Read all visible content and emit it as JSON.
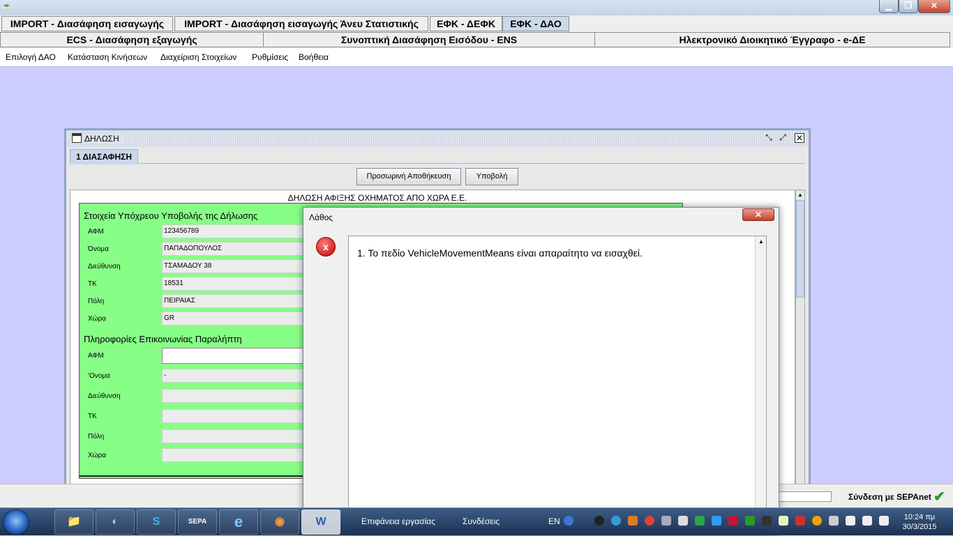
{
  "window": {
    "controls": {
      "minimize": "▁",
      "maximize": "❐",
      "close": "✕"
    }
  },
  "tabs_row1": [
    {
      "label": "IMPORT - Διασάφηση εισαγωγής",
      "selected": false
    },
    {
      "label": "IMPORT - Διασάφηση εισαγωγής Άνευ Στατιστικής",
      "selected": false
    },
    {
      "label": "ΕΦΚ - ΔΕΦΚ",
      "selected": false
    },
    {
      "label": "ΕΦΚ - ΔΑΟ",
      "selected": true
    }
  ],
  "tabs_row2": [
    {
      "label": "ECS - Διασάφηση εξαγωγής"
    },
    {
      "label": "Συνοπτική Διασάφηση Εισόδου - ENS"
    },
    {
      "label": "Ηλεκτρονικό Διοικητικό Έγγραφο - e-ΔΕ"
    }
  ],
  "menu": [
    "Επιλογή ΔΑΟ",
    "Κατάσταση Κινήσεων",
    "Διαχείριση Στοιχείων",
    "Ρυθμίσεις",
    "Βοήθεια"
  ],
  "internal_frame": {
    "title": "ΔΗΛΩΣΗ",
    "tab": "1 ΔΙΑΣΑΦΗΣΗ",
    "buttons": {
      "temp_save": "Προσωρινή Αποθήκευση",
      "submit": "Υποβολή"
    },
    "content_title": "ΔΗΛΩΣΗ ΑΦΙΞΗΣ ΟΧΗΜΑΤΟΣ ΑΠΟ ΧΩΡΑ Ε.Ε.",
    "section1": {
      "title": "Στοιχεία Υπόχρεου Υποβολής της Δήλωσης",
      "fields": [
        {
          "label": "ΑΦΜ",
          "value": "123456789"
        },
        {
          "label": "Όνομα",
          "value": "ΠΑΠΑΔΟΠΟΥΛΟΣ"
        },
        {
          "label": "Διεύθυνση",
          "value": "ΤΣΑΜΑΔΟΥ 38"
        },
        {
          "label": "ΤΚ",
          "value": "18531"
        },
        {
          "label": "Πόλη",
          "value": "ΠΕΙΡΑΙΑΣ"
        },
        {
          "label": "Χώρα",
          "value": "GR"
        }
      ]
    },
    "section2": {
      "title": "Πληροφορίες Επικοινωνίας Παραλήπτη",
      "fields": [
        {
          "label": "ΑΦΜ",
          "value": ""
        },
        {
          "label": "'Ονομα",
          "value": "-"
        },
        {
          "label": "Διεύθυνση",
          "value": ""
        },
        {
          "label": "ΤΚ",
          "value": ""
        },
        {
          "label": "Πόλη",
          "value": ""
        },
        {
          "label": "Χώρα",
          "value": ""
        }
      ]
    }
  },
  "dialog": {
    "title": "Λάθος",
    "close": "✕",
    "icon": "error-x-icon",
    "icon_glyph": "x",
    "messages": [
      "1.  Το πεδίο VehicleMovementMeans είναι απαραίτητο να εισαχθεί."
    ]
  },
  "status": {
    "connection": "Σύνδεση με SEPAnet"
  },
  "taskbar": {
    "apps": [
      {
        "name": "explorer",
        "glyph": "📁"
      },
      {
        "name": "app-2",
        "glyph": "◐"
      },
      {
        "name": "skype",
        "glyph": "S"
      },
      {
        "name": "sepa-desktop",
        "glyph": "SEPA"
      },
      {
        "name": "internet-explorer",
        "glyph": "e"
      },
      {
        "name": "firefox",
        "glyph": "◉"
      },
      {
        "name": "word",
        "glyph": "W"
      }
    ],
    "toolbars": [
      "Επιφάνεια εργασίας",
      "Συνδέσεις"
    ],
    "language": "EN",
    "clock": {
      "time": "10:24 πμ",
      "date": "30/3/2015"
    }
  },
  "colors": {
    "desktop_bg": "#ccccff",
    "panel_green": "#87ff87",
    "selected_tab": "#c9d9ec",
    "taskbar": "#1b3152"
  }
}
